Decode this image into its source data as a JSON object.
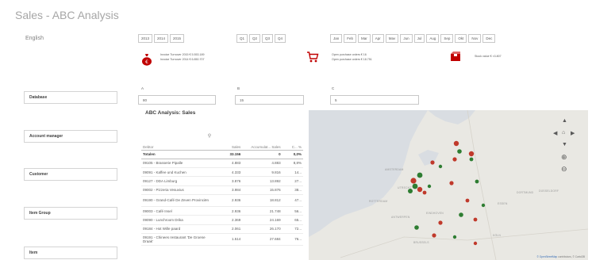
{
  "title": "Sales - ABC Analysis",
  "language": "English",
  "years": [
    "2013",
    "2014",
    "2015"
  ],
  "quarters": [
    "Q1",
    "Q2",
    "Q3",
    "Q4"
  ],
  "months": [
    "Jan",
    "Feb",
    "Mar",
    "Apr",
    "Mav",
    "Jun",
    "Jul",
    "Aug",
    "Sep",
    "Okt",
    "Nov",
    "Dec"
  ],
  "kpis": [
    {
      "icon": "moneybag-icon",
      "lines": [
        "Invoice Turnover 2015 € 5.553.189",
        "Invoice Turnover 2014 € 6.850.707"
      ]
    },
    {
      "icon": "shopping-cart-icon",
      "lines": [
        "Open purchase orders € 16",
        "Open purchase orders € 18.751"
      ]
    },
    {
      "icon": "box-icon",
      "lines": [
        "Stock value € ×3.807"
      ]
    }
  ],
  "filters": [
    "Database",
    "Account manager",
    "Customer",
    "Item Group",
    "Item"
  ],
  "abc_classes": [
    {
      "label": "A",
      "value": "80"
    },
    {
      "label": "B",
      "value": "15"
    },
    {
      "label": "C",
      "value": "5"
    }
  ],
  "table": {
    "title": "ABC Analysis: Sales",
    "columns": [
      "Debtor",
      "Sales",
      "Accumulat... Sales",
      "C... %"
    ],
    "totals": {
      "debtor": "Totalen",
      "sales": "33.156",
      "accum": "0",
      "pct": "0,0%"
    },
    "rows": [
      {
        "debtor": "09105 - Brasserie Pipalle",
        "sales": "4.883",
        "accum": "4.883",
        "pct": "8,8%"
      },
      {
        "debtor": "09091 - Kaffee und Kuchen",
        "sales": "4.333",
        "accum": "9.816",
        "pct": "14..."
      },
      {
        "debtor": "09127 - DDA Limburg",
        "sales": "3.876",
        "accum": "13.892",
        "pct": "27..."
      },
      {
        "debtor": "09002 - Pizzeria Vesuvius",
        "sales": "3.984",
        "accum": "15.876",
        "pct": "38..."
      },
      {
        "debtor": "09190 - Grand-Café De Zeven Provinciën",
        "sales": "2.936",
        "accum": "18.812",
        "pct": "47..."
      },
      {
        "debtor": "09003 - Café Insel",
        "sales": "2.936",
        "accum": "21.748",
        "pct": "56..."
      },
      {
        "debtor": "09090 - Lunchroom Drika",
        "sales": "2.369",
        "accum": "24.169",
        "pct": "65..."
      },
      {
        "debtor": "09184 - Hot Wille paard",
        "sales": "2.061",
        "accum": "26.170",
        "pct": "72..."
      },
      {
        "debtor": "09191 - Chinees restaurant 'De Groene Draak'",
        "sales": "1.514",
        "accum": "27.684",
        "pct": "76..."
      }
    ]
  },
  "map": {
    "labels": [
      "AMSTERDAM",
      "ROTTERDAM",
      "DÜSSELDORF",
      "BRUSSELS",
      "ESSEN",
      "DORTMUND",
      "UTRECHT",
      "ANTWERPEN",
      "EINDHOVEN",
      "KÖLN"
    ],
    "attribution_link": "© OpenStreetMap",
    "attribution_rest": "contributors, © CartoDB",
    "controls": {
      "up": "▲",
      "left": "◀",
      "right": "▶",
      "down": "▼",
      "home": "⌂",
      "zoom_in": "⊕",
      "zoom_out": "⊖"
    }
  },
  "more_menu": "•••",
  "colors": {
    "accent_red": "#c00000",
    "marker_red": "#c0392b",
    "marker_green": "#2e7d32",
    "map_land": "#e9e8e3",
    "map_water": "#d9dde2"
  }
}
